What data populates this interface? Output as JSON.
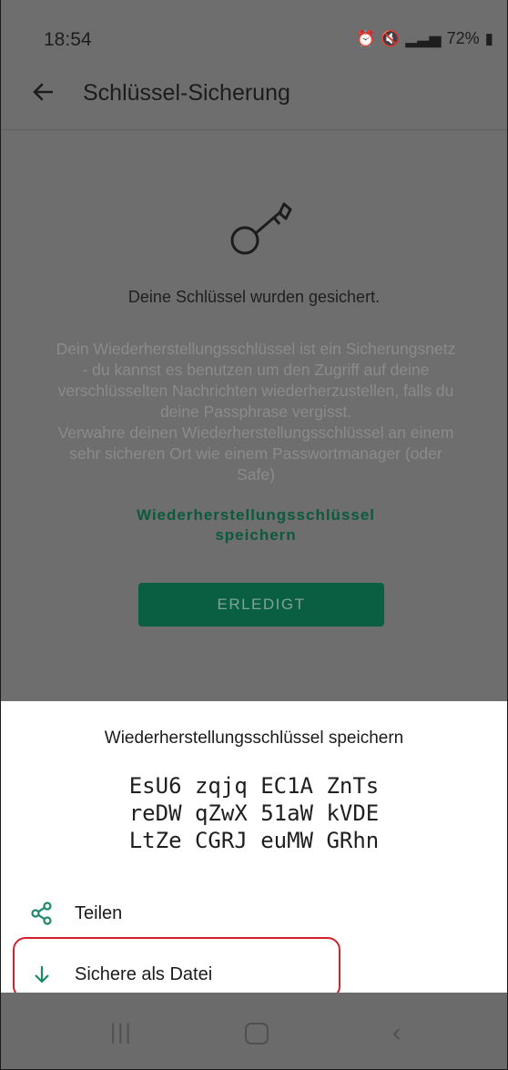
{
  "status_bar": {
    "time": "18:54",
    "battery": "72%",
    "icons": [
      "alarm-icon",
      "mute-icon",
      "wifi-icon",
      "signal-icon",
      "battery-icon"
    ]
  },
  "app_bar": {
    "title": "Schlüssel-Sicherung",
    "back_icon": "arrow-left-icon"
  },
  "content": {
    "key_icon": "key-icon",
    "saved_message": "Deine Schlüssel wurden gesichert.",
    "description_lines": [
      "Dein Wiederherstellungsschlüssel ist ein Sicherungsnetz",
      "- du kannst es benutzen um den Zugriff auf deine",
      "verschlüsselten Nachrichten wiederherzustellen, falls du",
      "deine Passphrase vergisst.",
      "Verwahre deinen Wiederherstellungsschlüssel an einem",
      "sehr sicheren Ort wie einem Passwortmanager (oder",
      "Safe)"
    ],
    "save_link_line1": "Wiederherstellungsschlüssel",
    "save_link_line2": "speichern",
    "done_button": "ERLEDIGT"
  },
  "bottom_sheet": {
    "title": "Wiederherstellungsschlüssel speichern",
    "recovery_key_lines": [
      "EsU6 zqjq EC1A ZnTs",
      "reDW qZwX 51aW kVDE",
      "LtZe CGRJ euMW GRhn"
    ],
    "share_label": "Teilen",
    "save_file_label": "Sichere als Datei",
    "accent_color": "#1a8a6a",
    "highlight_color": "#d0222c"
  },
  "nav_bar": {
    "recents_icon": "recents-icon",
    "home_icon": "home-icon",
    "back_icon": "back-icon"
  }
}
